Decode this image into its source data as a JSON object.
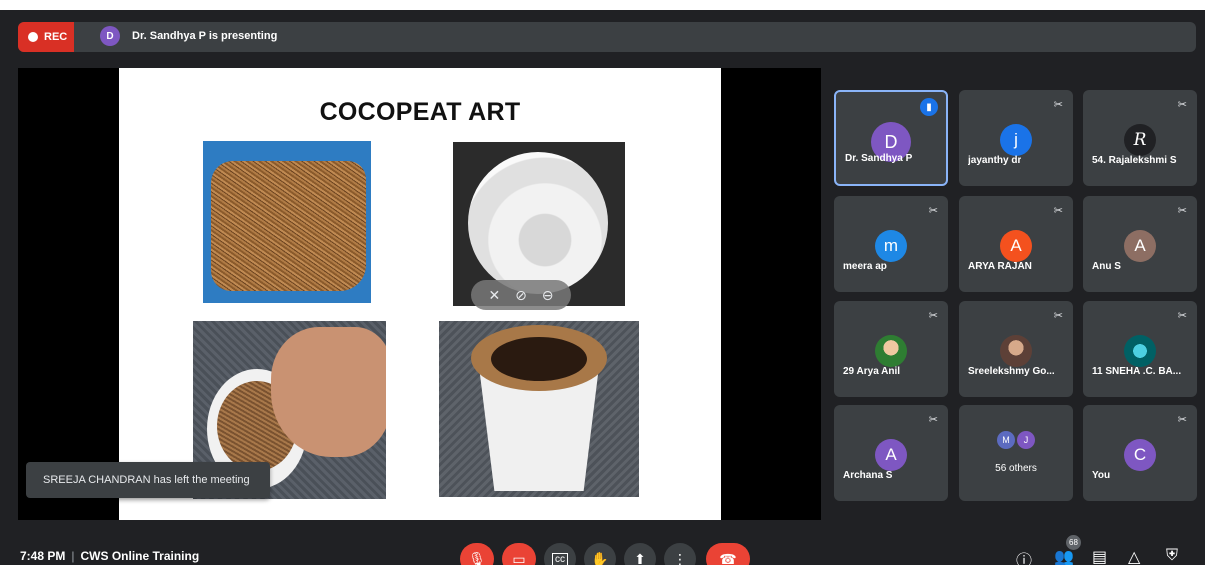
{
  "topbar": {
    "rec_label": "REC",
    "presenter_initial": "D",
    "presenter_text": "Dr. Sandhya P is presenting"
  },
  "slide": {
    "title": "COCOPEAT ART"
  },
  "toast": {
    "text": "SREEJA CHANDRAN has left the meeting"
  },
  "participants": [
    {
      "name": "Dr. Sandhya P",
      "initial": "D",
      "color": "#7e57c2",
      "speaking": true
    },
    {
      "name": "jayanthy dr",
      "initial": "j",
      "color": "#1a73e8",
      "muted": true
    },
    {
      "name": "54. Rajalekshmi S",
      "initial": "R",
      "color": "#202124",
      "muted": true
    },
    {
      "name": "meera ap",
      "initial": "m",
      "color": "#1e88e5",
      "muted": true
    },
    {
      "name": "ARYA RAJAN",
      "initial": "A",
      "color": "#f4511e",
      "muted": true
    },
    {
      "name": "Anu S",
      "initial": "A",
      "color": "#8d6e63",
      "muted": true
    },
    {
      "name": "29 Arya Anil",
      "initial": "",
      "color": "#2e7d32",
      "muted": true
    },
    {
      "name": "Sreelekshmy Go...",
      "initial": "",
      "color": "#5d4037",
      "muted": true
    },
    {
      "name": "11 SNEHA .C. BA...",
      "initial": "",
      "color": "#006064",
      "muted": true
    },
    {
      "name": "Archana S",
      "initial": "A",
      "color": "#7e57c2",
      "muted": true
    },
    {
      "name": "56 others",
      "initials": [
        "M",
        "J"
      ],
      "colors": [
        "#5c6bc0",
        "#7e57c2"
      ]
    },
    {
      "name": "You",
      "initial": "C",
      "color": "#7e57c2",
      "muted": true
    }
  ],
  "bottom": {
    "time": "7:48 PM",
    "meeting_name": "CWS Online Training",
    "participant_count": "68"
  }
}
